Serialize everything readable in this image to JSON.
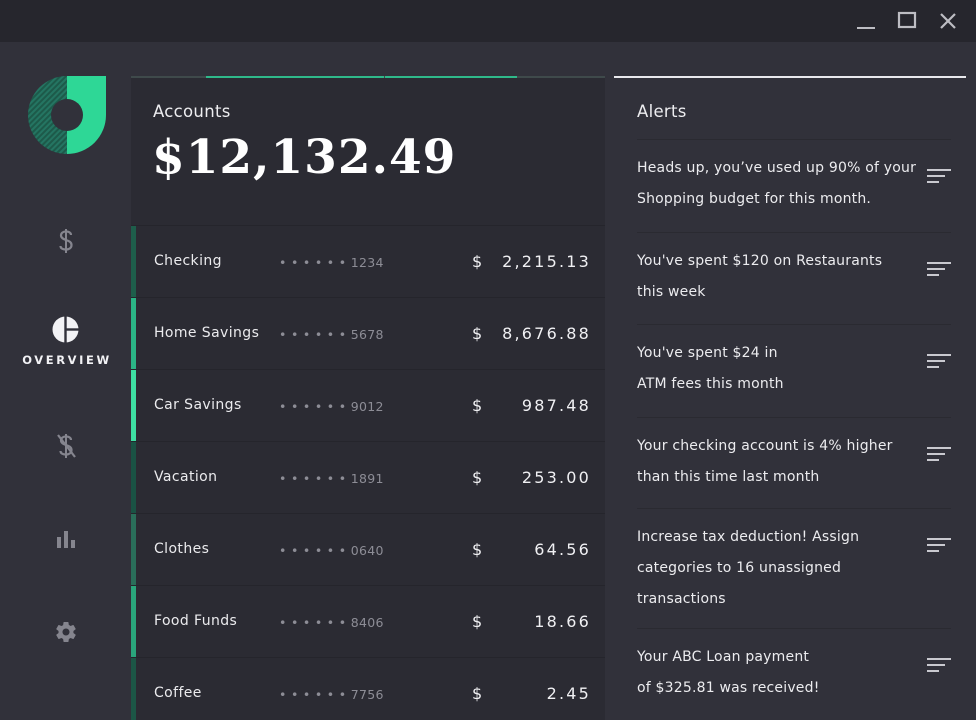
{
  "window": {
    "controls": [
      "minimize-icon",
      "maximize-icon",
      "close-icon"
    ]
  },
  "colors": {
    "accent": "#2fb98a",
    "accent_light": "#3ee0a3",
    "accent_dark": "#176b4e",
    "background": "#31313a",
    "panel": "#2b2b33"
  },
  "sidebar": {
    "logo": "app-logo",
    "items": [
      {
        "name": "accounts",
        "icon": "dollar-icon",
        "label": ""
      },
      {
        "name": "overview",
        "icon": "pie-chart-icon",
        "label": "OVERVIEW",
        "active": true
      },
      {
        "name": "transactions",
        "icon": "dollar-strikethrough-icon",
        "label": ""
      },
      {
        "name": "reports",
        "icon": "bar-chart-icon",
        "label": ""
      },
      {
        "name": "settings",
        "icon": "gear-icon",
        "label": ""
      }
    ]
  },
  "accounts": {
    "title": "Accounts",
    "total": "$12,132.49",
    "rows": [
      {
        "name": "Checking",
        "dots": "• • • • • •",
        "last4": "1234",
        "currency": "$",
        "amount": "2,215.13",
        "color": "#1e5e4b"
      },
      {
        "name": "Home Savings",
        "dots": "• • • • • •",
        "last4": "5678",
        "currency": "$",
        "amount": "8,676.88",
        "color": "#2bb586"
      },
      {
        "name": "Car Savings",
        "dots": "• • • • • •",
        "last4": "9012",
        "currency": "$",
        "amount": "987.48",
        "color": "#3ee0a3"
      },
      {
        "name": "Vacation",
        "dots": "• • • • • •",
        "last4": "1891",
        "currency": "$",
        "amount": "253.00",
        "color": "#1a5244"
      },
      {
        "name": "Clothes",
        "dots": "• • • • • •",
        "last4": "0640",
        "currency": "$",
        "amount": "64.56",
        "color": "#2a6e5a"
      },
      {
        "name": "Food Funds",
        "dots": "• • • • • •",
        "last4": "8406",
        "currency": "$",
        "amount": "18.66",
        "color": "#2aa67c"
      },
      {
        "name": "Coffee",
        "dots": "• • • • • •",
        "last4": "7756",
        "currency": "$",
        "amount": "2.45",
        "color": "#1c5646"
      }
    ]
  },
  "alerts": {
    "title": "Alerts",
    "items": [
      {
        "line1": "Heads up, you’ve used up 90% of your",
        "line2": "Shopping budget for this month.",
        "line3": ""
      },
      {
        "line1": "You've spent $120 on Restaurants",
        "line2": "this week",
        "line3": ""
      },
      {
        "line1": "You've spent $24 in",
        "line2": "ATM fees this month",
        "line3": ""
      },
      {
        "line1": "Your checking account is 4% higher",
        "line2": "than this time last month",
        "line3": ""
      },
      {
        "line1": "Increase tax deduction! Assign",
        "line2": "categories to 16 unassigned",
        "line3": "transactions"
      },
      {
        "line1": "Your ABC Loan payment",
        "line2": "of $325.81 was received!",
        "line3": ""
      }
    ]
  }
}
